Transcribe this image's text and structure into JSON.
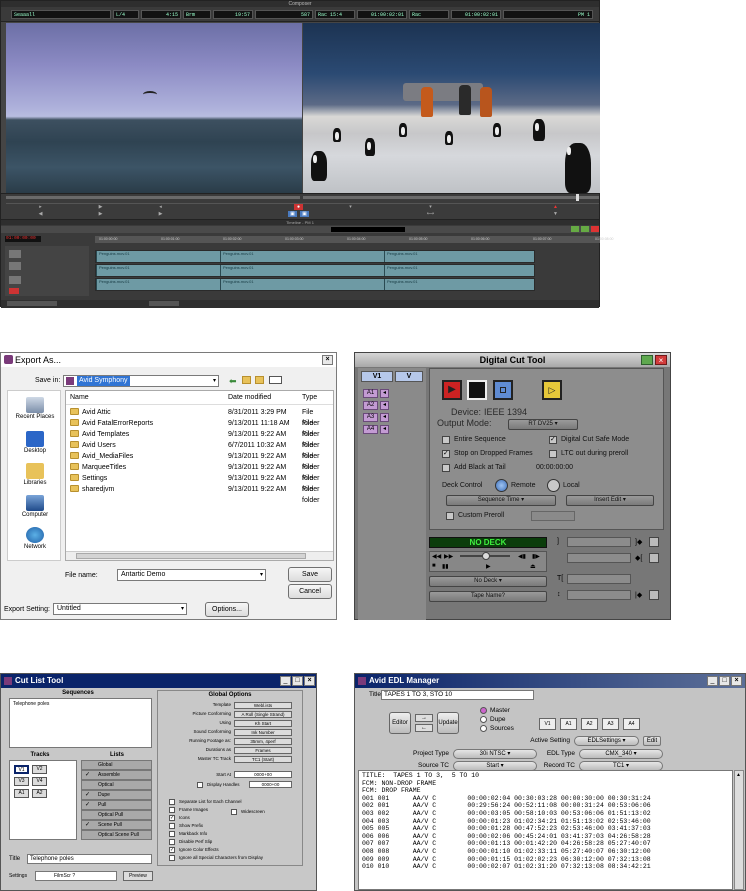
{
  "composer": {
    "title": "Composer",
    "timecodes": [
      "Seaaall",
      "L/4",
      "4:15",
      "Brm",
      "19:57",
      "587",
      "Rac 15:4",
      "01:00:02:01",
      "Rac",
      "01:00:02:01",
      "PM 1"
    ],
    "timeline_label": "Timeline - PM 1",
    "start_tc": "01:00:00:00",
    "ruler": [
      "01:00:00:00",
      "01:00:01:00",
      "01:00:02:00",
      "01:00:03:00",
      "01:00:04:00",
      "01:00:05:00",
      "01:00:06:00",
      "01:00:07:00",
      "01:00:08:00"
    ],
    "clip_name": "Penguins.mov.01"
  },
  "export": {
    "title": "Export As...",
    "save_in_label": "Save in:",
    "save_in_value": "Avid Symphony",
    "sidebar": [
      "Recent Places",
      "Desktop",
      "Libraries",
      "Computer",
      "Network"
    ],
    "columns": [
      "Name",
      "Date modified",
      "Type"
    ],
    "files": [
      {
        "name": "Avid Attic",
        "date": "8/31/2011 3:29 PM",
        "type": "File folder"
      },
      {
        "name": "Avid FatalErrorReports",
        "date": "9/13/2011 11:18 AM",
        "type": "File folder"
      },
      {
        "name": "Avid Templates",
        "date": "9/13/2011 9:22 AM",
        "type": "File folder"
      },
      {
        "name": "Avid Users",
        "date": "6/7/2011 10:32 AM",
        "type": "File folder"
      },
      {
        "name": "Avid_MediaFiles",
        "date": "9/13/2011 9:22 AM",
        "type": "File folder"
      },
      {
        "name": "MarqueeTitles",
        "date": "9/13/2011 9:22 AM",
        "type": "File folder"
      },
      {
        "name": "Settings",
        "date": "9/13/2011 9:22 AM",
        "type": "File folder"
      },
      {
        "name": "sharedjvm",
        "date": "9/13/2011 9:22 AM",
        "type": "File folder"
      }
    ],
    "file_name_label": "File name:",
    "file_name_value": "Antartic Demo",
    "save_label": "Save",
    "cancel_label": "Cancel",
    "export_setting_label": "Export Setting:",
    "export_setting_value": "Untitled",
    "options_label": "Options..."
  },
  "dcut": {
    "title": "Digital Cut Tool",
    "v1": "V1",
    "v": "V",
    "audio_tracks": [
      "A1",
      "A2",
      "A3",
      "A4"
    ],
    "device_label": "Device:",
    "device_value": "IEEE 1394",
    "output_mode_label": "Output Mode:",
    "output_mode_value": "RT DV25",
    "entire_sequence": "Entire Sequence",
    "digital_cut_safe_mode": "Digital Cut Safe Mode",
    "stop_on_dropped": "Stop on Dropped Frames",
    "ltc_out": "LTC out during preroll",
    "add_black": "Add Black at Tail",
    "black_tc": "00:00:00:00",
    "deck_control": "Deck Control",
    "remote": "Remote",
    "local": "Local",
    "sequence_time": "Sequence Time",
    "insert_edit": "Insert Edit",
    "custom_preroll": "Custom Preroll",
    "no_deck_status": "NO DECK",
    "no_deck_menu": "No Deck",
    "tape_name": "Tape Name?"
  },
  "cutlist": {
    "title": "Cut List Tool",
    "sequences_label": "Sequences",
    "sequence_item": "Telephone poles",
    "tracks_label": "Tracks",
    "lists_label": "Lists",
    "tracks": [
      "V1",
      "V2",
      "V3",
      "V4",
      "A1",
      "A2"
    ],
    "lists": [
      {
        "label": "Global",
        "checked": false
      },
      {
        "label": "Assemble",
        "checked": true
      },
      {
        "label": "Optical",
        "checked": false
      },
      {
        "label": "Dupe",
        "checked": true
      },
      {
        "label": "Pull",
        "checked": true
      },
      {
        "label": "Optical Pull",
        "checked": false
      },
      {
        "label": "Scene Pull",
        "checked": true
      },
      {
        "label": "Optical Scene Pull",
        "checked": false
      }
    ],
    "global_options": "Global Options",
    "options": [
      {
        "label": "Template",
        "value": "Webl.ists"
      },
      {
        "label": "Picture Conforming",
        "value": "A Roll (Single Strand)"
      },
      {
        "label": "Using",
        "value": "Kh Start"
      },
      {
        "label": "Sound Conforming",
        "value": "Ink Number"
      },
      {
        "label": "Running Footage as:",
        "value": "35mm, 4perf"
      },
      {
        "label": "Durations as",
        "value": "Frames"
      },
      {
        "label": "Master TC Track",
        "value": "TC1 (Start)"
      }
    ],
    "start_at_label": "Start At",
    "start_at_value": "0000+00",
    "display_handles": "Display Handles",
    "handles_value": "0000+00",
    "checks": [
      {
        "label": "Separate List for Each Channel",
        "checked": false
      },
      {
        "label": "Frame Images",
        "checked": false
      },
      {
        "label": "Icons",
        "checked": true
      },
      {
        "label": "Show Prefix",
        "checked": false
      },
      {
        "label": "Markback Info",
        "checked": false
      },
      {
        "label": "Disable Perf Slip",
        "checked": false
      },
      {
        "label": "Ignore Color Effects",
        "checked": true
      },
      {
        "label": "Ignore all Special Characters from Display",
        "checked": false
      }
    ],
    "widescreen": "Widescreen",
    "title_label": "Title",
    "title_value": "Telephone poles",
    "settings_label": "Settings",
    "settings_value": "FilmScr ?",
    "preview_label": "Preview"
  },
  "edl": {
    "title": "Avid EDL Manager",
    "title_label": "Title",
    "title_value": "TAPES 1 TO 3, STO 10",
    "editor": "Editor",
    "update": "Update",
    "radio": [
      "Master",
      "Dupe",
      "Sources"
    ],
    "tracks": [
      "V1",
      "A1",
      "A2",
      "A3",
      "A4"
    ],
    "active_setting_label": "Active Setting",
    "active_setting_value": "EDLSettings",
    "edit_label": "Edit",
    "project_type_label": "Project Type",
    "project_type_value": "30i NTSC",
    "edl_type_label": "EDL Type",
    "edl_type_value": "CMX_340",
    "source_tc_label": "Source TC",
    "source_tc_value": "Start",
    "record_tc_label": "Record TC",
    "record_tc_value": "TC1",
    "header_lines": [
      "TITLE:  TAPES 1 TO 3,  5 TO 10",
      "FCM: NON-DROP FRAME",
      "FCM: DROP FRAME"
    ],
    "events": [
      "001 001      AA/V C        00:00:02:04 00:30:03:28 00:00:30:00 00:30:31:24",
      "002 001      AA/V C        00:29:56:24 00:52:11:08 00:00:31:24 00:53:06:06",
      "003 002      AA/V C        00:00:03:05 00:58:10:03 00:53:06:06 01:51:13:02",
      "004 003      AA/V C        00:00:01:23 01:02:34:21 01:51:13:02 02:53:46:00",
      "005 005      AA/V C        00:00:01:28 00:47:52:23 02:53:46:00 03:41:37:03",
      "006 006      AA/V C        00:00:02:06 00:45:24:01 03:41:37:03 04:26:58:28",
      "007 007      AA/V C        00:00:01:13 00:01:42:20 04:26:58:28 05:27:40:07",
      "008 008      AA/V C        00:00:01:10 01:02:33:11 05:27:40:07 06:30:12:00",
      "009 009      AA/V C        00:00:01:15 01:02:02:23 06:30:12:00 07:32:13:08",
      "010 010      AA/V C        00:00:02:07 01:02:31:20 07:32:13:08 08:34:42:21"
    ]
  }
}
